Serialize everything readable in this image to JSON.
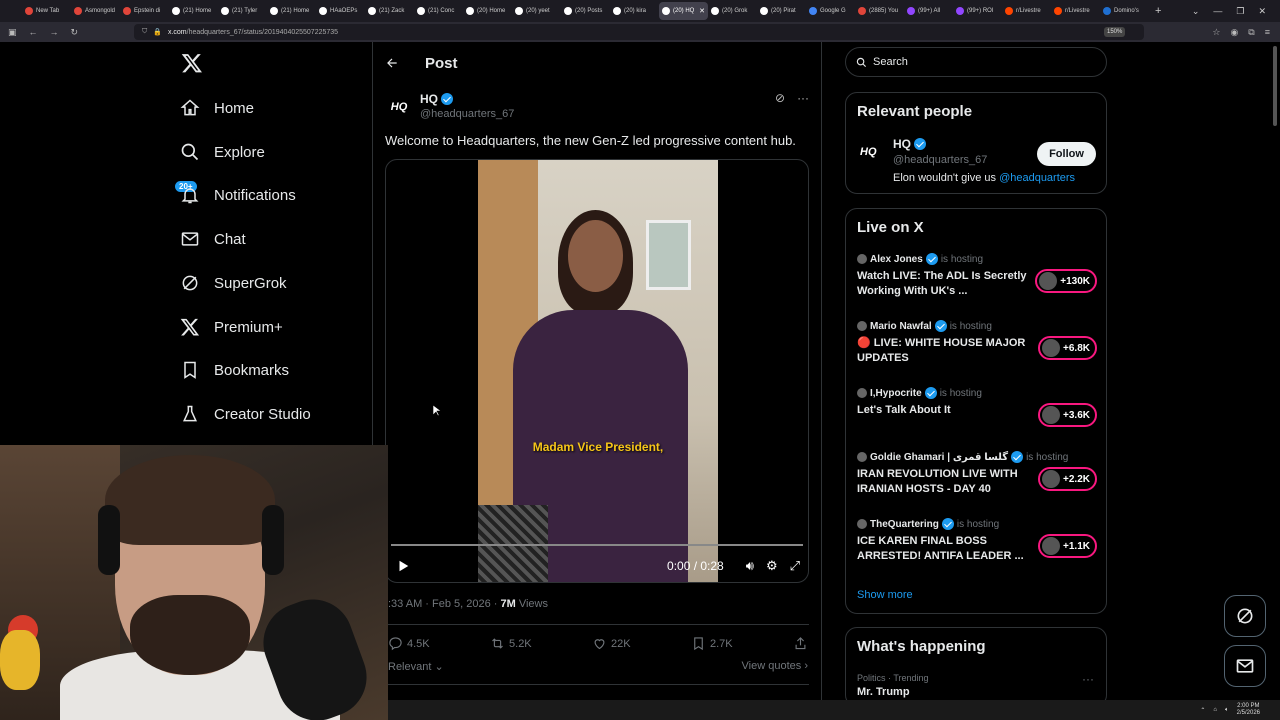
{
  "browser": {
    "tabs": [
      {
        "label": "New Tab",
        "color": "#e0453a"
      },
      {
        "label": "Asmongold",
        "color": "#e0453a"
      },
      {
        "label": "Epstein di",
        "color": "#e0453a"
      },
      {
        "label": "(21) Home",
        "color": "#ffffff"
      },
      {
        "label": "(21) Tyler",
        "color": "#ffffff"
      },
      {
        "label": "(21) Home",
        "color": "#ffffff"
      },
      {
        "label": "HAaOEPs",
        "color": "#ffffff"
      },
      {
        "label": "(21) Zack",
        "color": "#ffffff"
      },
      {
        "label": "(21) Conc",
        "color": "#ffffff"
      },
      {
        "label": "(20) Home",
        "color": "#ffffff"
      },
      {
        "label": "(20) yeet",
        "color": "#ffffff"
      },
      {
        "label": "(20) Posts",
        "color": "#ffffff"
      },
      {
        "label": "(20) kira",
        "color": "#ffffff"
      },
      {
        "label": "(20) HQ",
        "color": "#ffffff",
        "active": true
      },
      {
        "label": "(20) Grok",
        "color": "#ffffff"
      },
      {
        "label": "(20) Pirat",
        "color": "#ffffff"
      },
      {
        "label": "Google G",
        "color": "#4285f4"
      },
      {
        "label": "(2885) You",
        "color": "#e0453a"
      },
      {
        "label": "(99+) All",
        "color": "#9146ff"
      },
      {
        "label": "(99+) ROI",
        "color": "#9146ff"
      },
      {
        "label": "r/Livestre",
        "color": "#ff4500"
      },
      {
        "label": "r/Livestre",
        "color": "#ff4500"
      },
      {
        "label": "Domino's",
        "color": "#1f6fd1"
      }
    ],
    "new_tab": "+",
    "url_host": "x.com",
    "url_path": "/headquarters_67/status/2019404025507225735",
    "zoom": "150%"
  },
  "nav": {
    "items": [
      {
        "label": "Home",
        "icon": "home-icon"
      },
      {
        "label": "Explore",
        "icon": "search-icon"
      },
      {
        "label": "Notifications",
        "icon": "bell-icon"
      },
      {
        "label": "Chat",
        "icon": "mail-icon"
      },
      {
        "label": "SuperGrok",
        "icon": "grok-icon"
      },
      {
        "label": "Premium+",
        "icon": "x-icon"
      },
      {
        "label": "Bookmarks",
        "icon": "bookmark-icon"
      },
      {
        "label": "Creator Studio",
        "icon": "flask-icon"
      }
    ],
    "notifications_badge": "20+"
  },
  "post": {
    "header_title": "Post",
    "author_avatar": "HQ",
    "author_name": "HQ",
    "author_handle": "@headquarters_67",
    "text": "Welcome to Headquarters, the new Gen-Z led progressive content hub.",
    "video_caption": "Madam Vice President,",
    "video_time": "0:00 / 0:28",
    "video_progress": 0,
    "time": ":33 AM · Feb 5, 2026 · ",
    "views_count": "7M",
    "views_label": " Views",
    "replies": "4.5K",
    "reposts": "5.2K",
    "likes": "22K",
    "bookmarks": "2.7K",
    "sort_label": "Relevant",
    "view_quotes": "View quotes"
  },
  "right": {
    "search_placeholder": "Search",
    "relevant_people": {
      "title": "Relevant people",
      "avatar": "HQ",
      "name": "HQ",
      "handle": "@headquarters_67",
      "bio_text": "Elon wouldn't give us ",
      "bio_link": "@headquarters",
      "follow_label": "Follow"
    },
    "live": {
      "title": "Live on X",
      "items": [
        {
          "host": "Alex Jones",
          "status": "is hosting",
          "title": "Watch LIVE: The ADL Is Secretly Working With UK's ...",
          "count": "+130K"
        },
        {
          "host": "Mario Nawfal",
          "status": "is hosting",
          "title": "🔴 LIVE: WHITE HOUSE MAJOR UPDATES",
          "count": "+6.8K"
        },
        {
          "host": "I,Hypocrite",
          "status": "is hosting",
          "title": "Let's Talk About It",
          "count": "+3.6K"
        },
        {
          "host": "Goldie Ghamari | گلسا قمری",
          "status": "is hosting",
          "title": "IRAN REVOLUTION LIVE WITH IRANIAN HOSTS - DAY 40",
          "count": "+2.2K"
        },
        {
          "host": "TheQuartering",
          "status": "is hosting",
          "title": "ICE KAREN FINAL BOSS ARRESTED! ANTIFA LEADER ...",
          "count": "+1.1K"
        }
      ],
      "show_more": "Show more"
    },
    "trending": {
      "title": "What's happening",
      "category": "Politics · Trending",
      "name": "Mr. Trump",
      "more": "···"
    }
  },
  "taskbar": {
    "time": "2:00 PM",
    "date": "2/5/2026"
  },
  "colors": {
    "accent": "#1d9bf0",
    "live_ring": "#f91880",
    "caption": "#f5c518"
  }
}
